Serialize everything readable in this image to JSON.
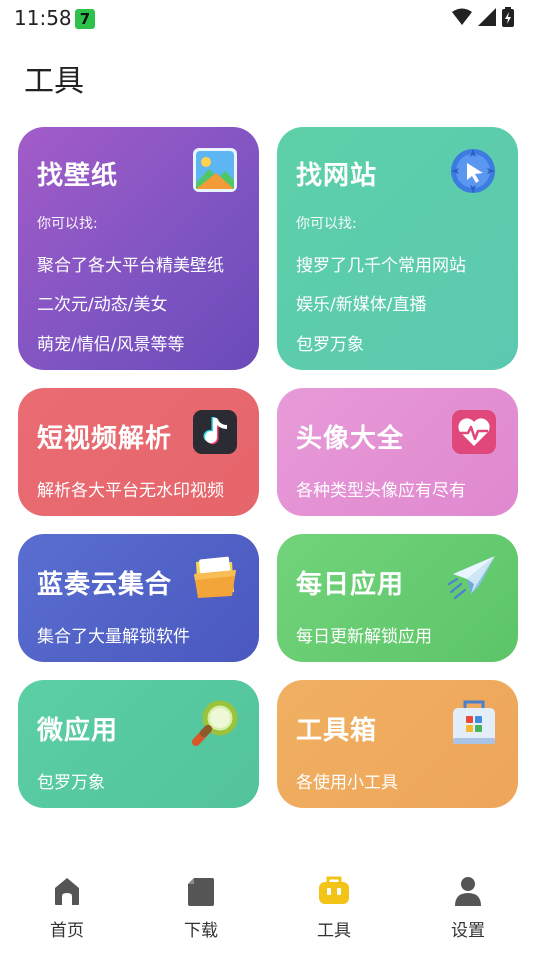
{
  "status": {
    "time": "11:58",
    "badge": "7"
  },
  "page": {
    "title": "工具"
  },
  "cards": [
    {
      "title": "找壁纸",
      "sub": "你可以找:",
      "lines": [
        "聚合了各大平台精美壁纸",
        "二次元/动态/美女",
        "萌宠/情侣/风景等等"
      ],
      "icon": "wallpaper-icon"
    },
    {
      "title": "找网站",
      "sub": "你可以找:",
      "lines": [
        "搜罗了几千个常用网站",
        "娱乐/新媒体/直播",
        "包罗万象"
      ],
      "icon": "compass-cursor-icon"
    },
    {
      "title": "短视频解析",
      "lines": [
        "解析各大平台无水印视频"
      ],
      "icon": "music-note-icon"
    },
    {
      "title": "头像大全",
      "lines": [
        "各种类型头像应有尽有"
      ],
      "icon": "heart-pulse-icon"
    },
    {
      "title": "蓝奏云集合",
      "lines": [
        "集合了大量解锁软件"
      ],
      "icon": "folder-icon"
    },
    {
      "title": "每日应用",
      "lines": [
        "每日更新解锁应用"
      ],
      "icon": "paper-plane-icon"
    },
    {
      "title": "微应用",
      "lines": [
        "包罗万象"
      ],
      "icon": "magnifier-icon"
    },
    {
      "title": "工具箱",
      "lines": [
        "各使用小工具"
      ],
      "icon": "toolbox-icon"
    }
  ],
  "tabs": [
    {
      "label": "首页",
      "icon": "home-icon"
    },
    {
      "label": "下载",
      "icon": "download-icon"
    },
    {
      "label": "工具",
      "icon": "toolbox-icon",
      "active": true
    },
    {
      "label": "设置",
      "icon": "person-icon"
    }
  ],
  "colors": {
    "active_tab": "#f2c418",
    "inactive_tab": "#555555"
  }
}
